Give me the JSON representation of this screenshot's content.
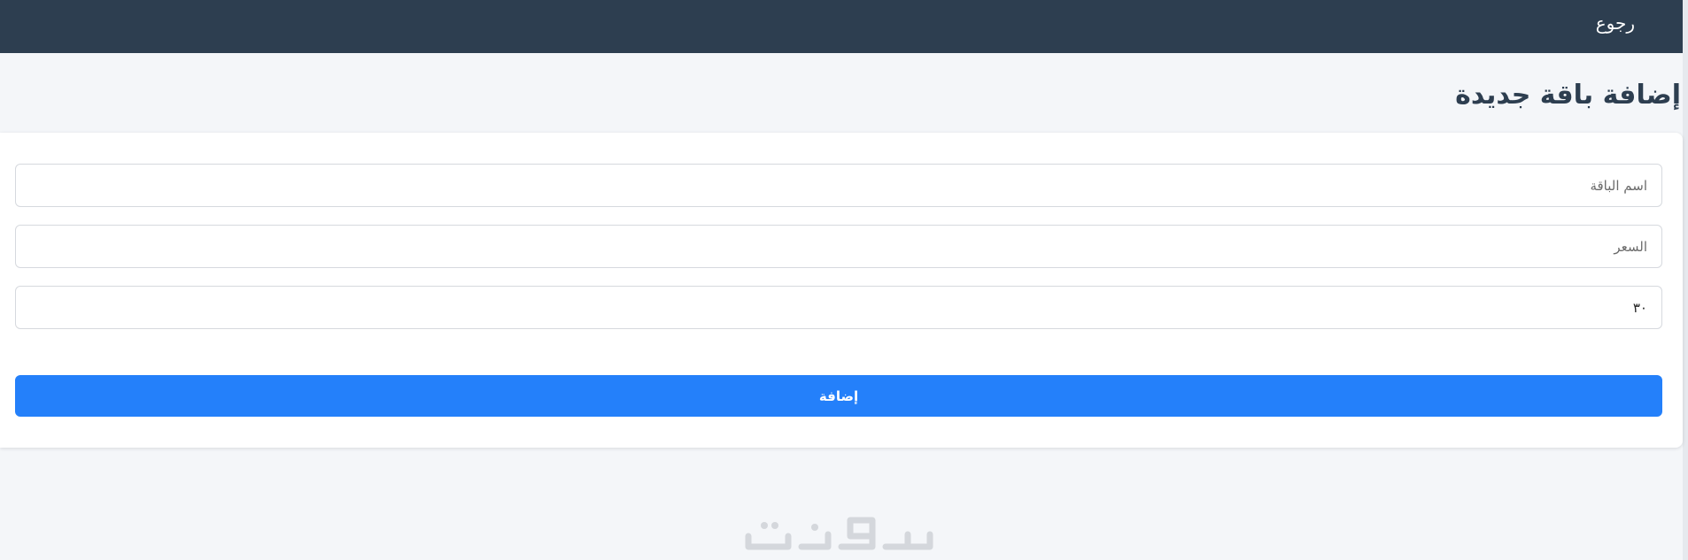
{
  "header": {
    "back_label": "رجوع",
    "background_color": "#2d3e50"
  },
  "page": {
    "title": "إضافة باقة جديدة"
  },
  "form": {
    "package_name_placeholder": "اسم الباقة",
    "package_name_value": "",
    "price_placeholder": "السعر",
    "price_value": "",
    "duration_value": "٣٠",
    "submit_label": "إضافة",
    "submit_color": "#2480fa"
  },
  "watermark": {
    "text": "خمسات",
    "icon": "khamsat-logo-watermark"
  }
}
